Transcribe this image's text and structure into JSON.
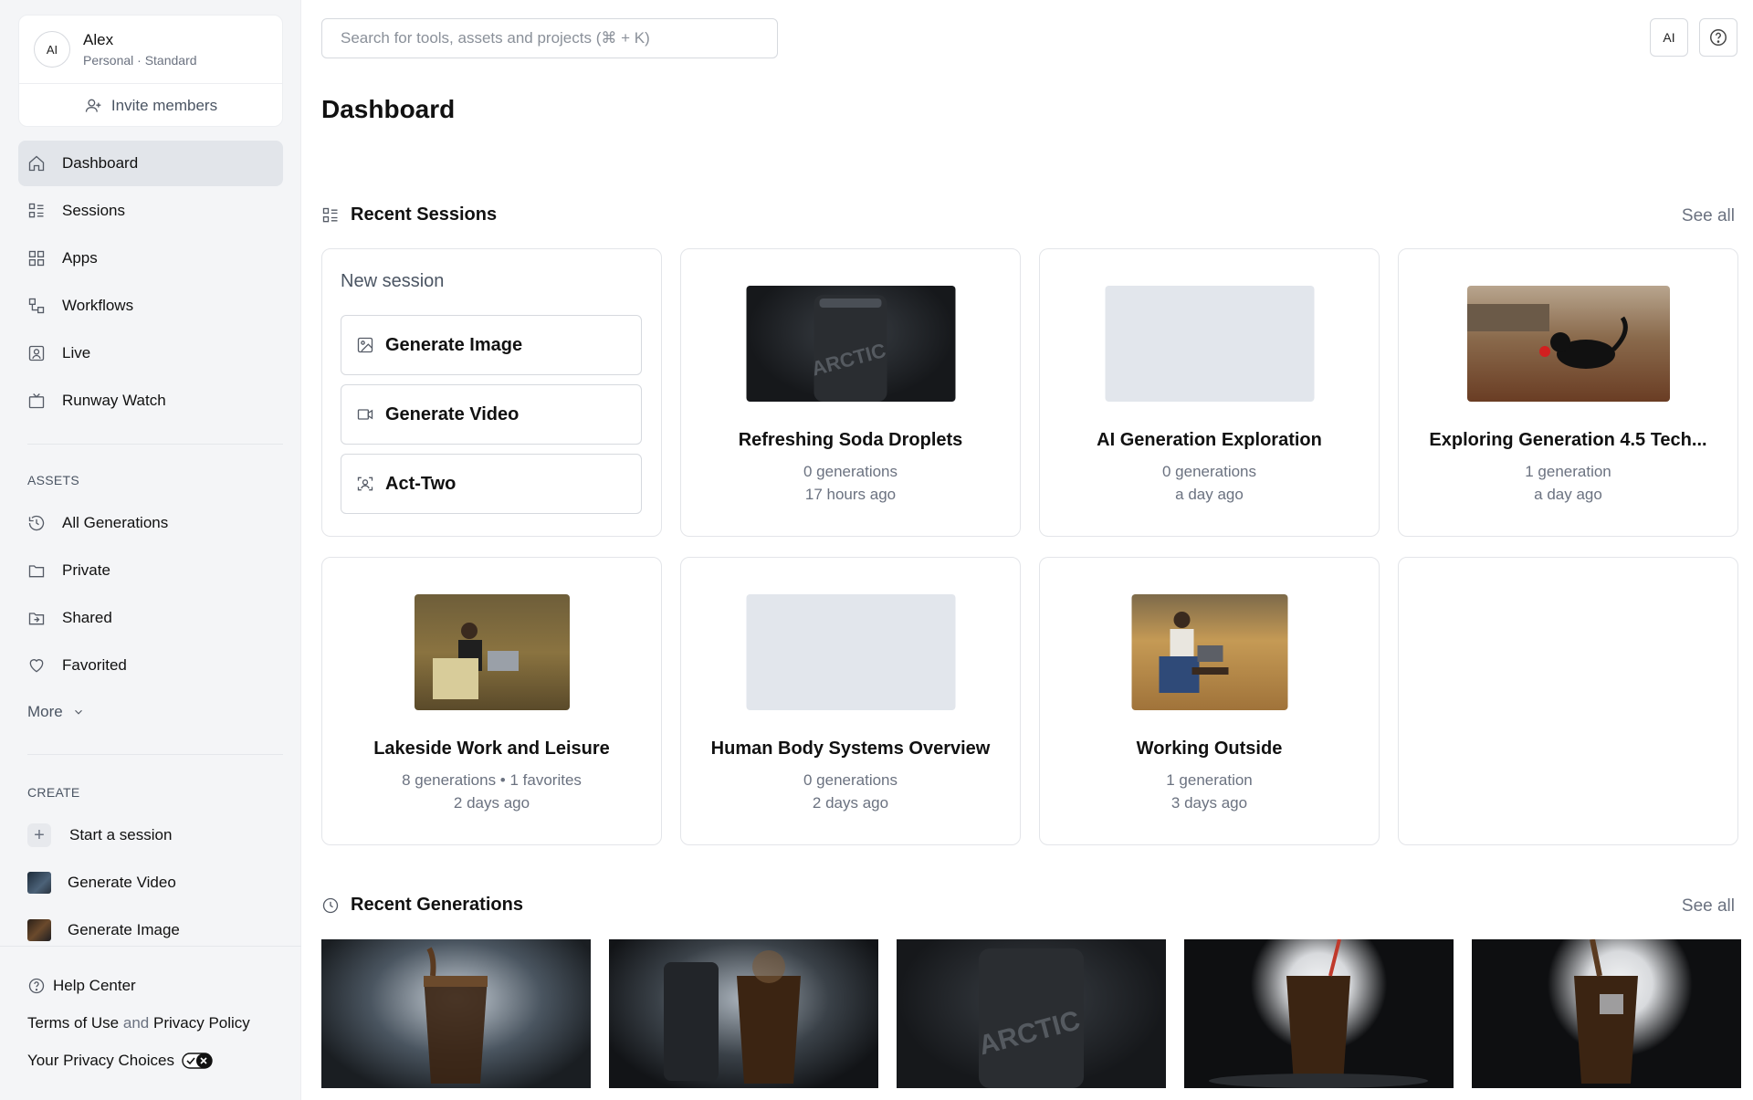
{
  "account": {
    "avatar_initials": "AI",
    "name": "Alex",
    "plan": "Personal · Standard",
    "invite_label": "Invite members"
  },
  "nav": {
    "items": [
      {
        "label": "Dashboard",
        "icon": "home-icon",
        "active": true
      },
      {
        "label": "Sessions",
        "icon": "sessions-icon"
      },
      {
        "label": "Apps",
        "icon": "apps-icon"
      },
      {
        "label": "Workflows",
        "icon": "workflows-icon"
      },
      {
        "label": "Live",
        "icon": "live-icon"
      },
      {
        "label": "Runway Watch",
        "icon": "tv-icon"
      }
    ]
  },
  "assets": {
    "heading": "ASSETS",
    "items": [
      {
        "label": "All Generations",
        "icon": "history-icon"
      },
      {
        "label": "Private",
        "icon": "folder-icon"
      },
      {
        "label": "Shared",
        "icon": "shared-folder-icon"
      },
      {
        "label": "Favorited",
        "icon": "heart-icon"
      }
    ],
    "more_label": "More"
  },
  "create": {
    "heading": "CREATE",
    "items": [
      {
        "label": "Start a session"
      },
      {
        "label": "Generate Video"
      },
      {
        "label": "Generate Image"
      }
    ]
  },
  "footer": {
    "help": "Help Center",
    "terms": "Terms of Use",
    "and": "and",
    "privacy": "Privacy Policy",
    "privacy_choices": "Your Privacy Choices"
  },
  "header": {
    "search_placeholder": "Search for tools, assets and projects (⌘ + K)",
    "ai_button": "AI",
    "help_icon": "help-circle-icon"
  },
  "page_title": "Dashboard",
  "recent_sessions": {
    "heading": "Recent Sessions",
    "see_all": "See all",
    "new_session": {
      "label": "New session",
      "buttons": [
        "Generate Image",
        "Generate Video",
        "Act-Two"
      ]
    },
    "cards": [
      {
        "title": "Refreshing Soda Droplets",
        "meta": "0 generations",
        "time": "17 hours ago"
      },
      {
        "title": "AI Generation Exploration",
        "meta": "0 generations",
        "time": "a day ago"
      },
      {
        "title": "Exploring Generation 4.5 Tech...",
        "meta": "1 generation",
        "time": "a day ago"
      },
      {
        "title": "Lakeside Work and Leisure",
        "meta": "8 generations • 1 favorites",
        "time": "2 days ago"
      },
      {
        "title": "Human Body Systems Overview",
        "meta": "0 generations",
        "time": "2 days ago"
      },
      {
        "title": "Working Outside",
        "meta": "1 generation",
        "time": "3 days ago"
      }
    ]
  },
  "recent_generations": {
    "heading": "Recent Generations",
    "see_all": "See all"
  },
  "colors": {
    "sidebar_bg": "#f4f5f7",
    "active_nav_bg": "#e2e5ea",
    "border": "#e3e5e9",
    "muted_text": "#6b7280"
  }
}
